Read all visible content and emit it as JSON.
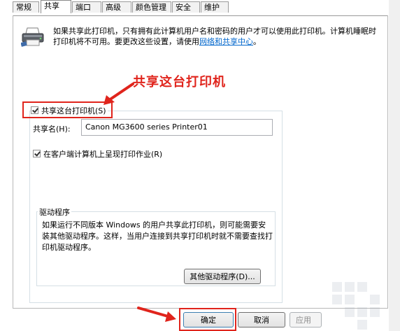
{
  "tabs": [
    {
      "label": "常规",
      "active": false
    },
    {
      "label": "共享",
      "active": true
    },
    {
      "label": "端口",
      "active": false
    },
    {
      "label": "高级",
      "active": false
    },
    {
      "label": "颜色管理",
      "active": false
    },
    {
      "label": "安全",
      "active": false
    },
    {
      "label": "维护",
      "active": false
    }
  ],
  "info": {
    "text": "如果共享此打印机，只有拥有此计算机用户名和密码的用户才可以使用此打印机。计算机睡眠时打印机将不可用。要更改这些设置，请使用",
    "link": "网络和共享中心",
    "suffix": "。"
  },
  "annotation": {
    "label": "共享这台打印机",
    "color": "#e0241c"
  },
  "share": {
    "checkbox_label": "共享这台打印机(S)",
    "checked": true,
    "name_label": "共享名(H):",
    "name_value": "Canon MG3600 series Printer01",
    "render_label": "在客户端计算机上呈现打印作业(R)",
    "render_checked": true
  },
  "driver": {
    "legend": "驱动程序",
    "text": "如果运行不同版本 Windows 的用户共享此打印机，则可能需要安装其他驱动程序。这样，当用户连接到共享打印机时就不需要查找打印机驱动程序。",
    "button": "其他驱动程序(D)..."
  },
  "buttons": {
    "ok": "确定",
    "cancel": "取消",
    "apply": "应用"
  },
  "icons": {
    "printer": "printer-icon",
    "watermark": "watermark-logo"
  }
}
